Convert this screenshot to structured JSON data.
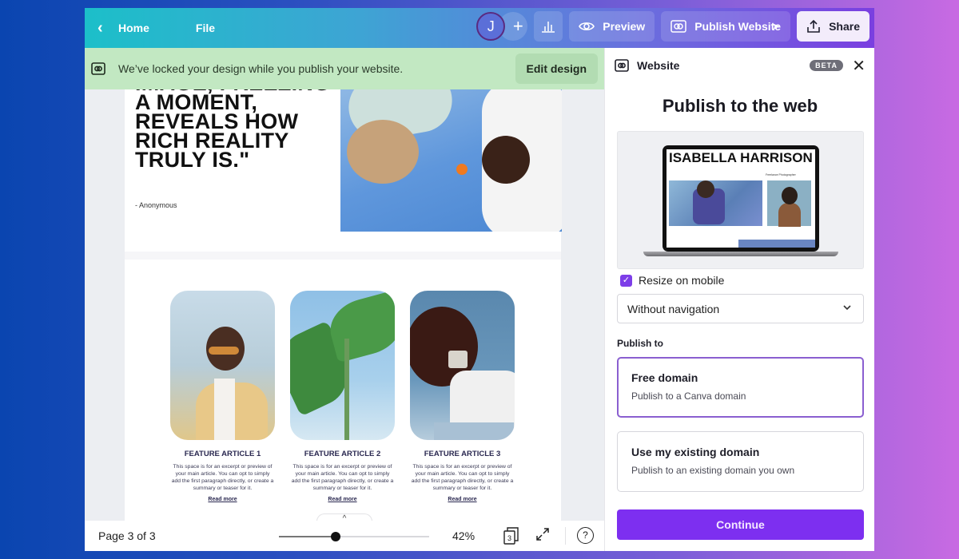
{
  "topbar": {
    "home_label": "Home",
    "file_label": "File",
    "avatar_initial": "J",
    "add_label": "+",
    "preview_label": "Preview",
    "publish_label": "Publish Website",
    "share_label": "Share"
  },
  "banner": {
    "message": "We’ve locked your design while you publish your website.",
    "edit_label": "Edit design"
  },
  "canvas": {
    "quote_lines": "IMAGE, FREEZING A MOMENT, REVEALS HOW RICH REALITY TRULY IS.\"",
    "quote_author": "- Anonymous",
    "articles": [
      {
        "title": "FEATURE ARTICLE 1",
        "body": "This space is for an excerpt or preview of your main article. You can opt to simply add the first paragraph directly, or create a summary or teaser for it.",
        "link": "Read more"
      },
      {
        "title": "FEATURE ARTICLE 2",
        "body": "This space is for an excerpt or preview of your main article. You can opt to simply add the first paragraph directly, or create a summary or teaser for it.",
        "link": "Read more"
      },
      {
        "title": "FEATURE ARTICLE 3",
        "body": "This space is for an excerpt or preview of your main article. You can opt to simply add the first paragraph directly, or create a summary or teaser for it.",
        "link": "Read more"
      }
    ],
    "collapse_glyph": "^"
  },
  "footer": {
    "page_indicator": "Page 3 of 3",
    "zoom_percent": 42,
    "zoom_label": "42%",
    "zoom_slider_fraction": 0.38,
    "pages_count": "3",
    "help_glyph": "?"
  },
  "panel": {
    "title": "Website",
    "badge": "BETA",
    "heading": "Publish to the web",
    "preview": {
      "site_name": "ISABELLA HARRISON",
      "site_subtitle": "Freelance Photographer"
    },
    "resize_label": "Resize on mobile",
    "resize_checked": true,
    "navigation_select": "Without navigation",
    "publish_to_label": "Publish to",
    "options": [
      {
        "title": "Free domain",
        "desc": "Publish to a Canva domain",
        "selected": true
      },
      {
        "title": "Use my existing domain",
        "desc": "Publish to an existing domain you own",
        "selected": false
      }
    ],
    "continue_label": "Continue"
  },
  "colors": {
    "accent_purple": "#7d2ff0",
    "banner_green": "#c2e8c2",
    "selected_border": "#8a5fd0"
  }
}
